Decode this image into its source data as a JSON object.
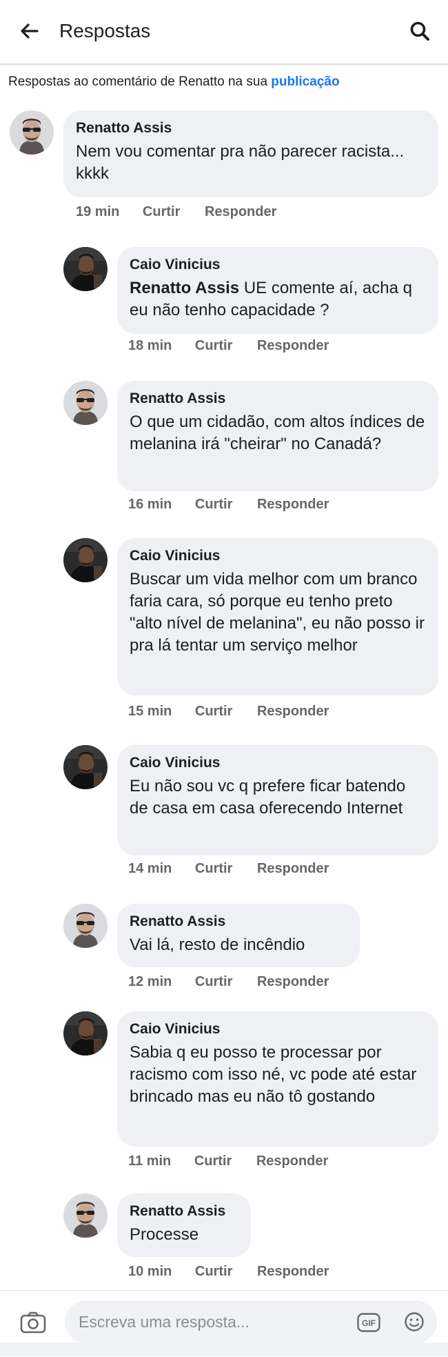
{
  "header": {
    "back_icon": "arrow-left-icon",
    "title": "Respostas",
    "search_icon": "search-icon"
  },
  "context": {
    "text": "Respostas ao comentário de Renatto na sua ",
    "link": "publicação"
  },
  "comments": [
    {
      "author": "Renatto Assis",
      "mention": "",
      "text": "Nem vou comentar pra não parecer racista... kkkk",
      "time": "19 min",
      "like": "Curtir",
      "reply": "Responder",
      "avatar": "renatto-avatar"
    },
    {
      "author": "Caio Vinicius",
      "mention": "Renatto Assis",
      "text": " UE comente aí, acha q eu não tenho capacidade ?",
      "time": "18 min",
      "like": "Curtir",
      "reply": "Responder",
      "avatar": "caio-avatar"
    },
    {
      "author": "Renatto Assis",
      "mention": "",
      "text": "O que um cidadão, com altos índices de melanina irá \"cheirar\" no Canadá?",
      "time": "16 min",
      "like": "Curtir",
      "reply": "Responder",
      "avatar": "renatto-avatar"
    },
    {
      "author": "Caio Vinicius",
      "mention": "",
      "text": "Buscar um vida melhor com um branco faria cara, só porque eu tenho preto \"alto nível de melanina\", eu não posso ir pra lá tentar um serviço melhor",
      "time": "15 min",
      "like": "Curtir",
      "reply": "Responder",
      "avatar": "caio-avatar"
    },
    {
      "author": "Caio Vinicius",
      "mention": "",
      "text": "Eu não sou vc q prefere ficar batendo de casa em casa oferecendo Internet",
      "time": "14 min",
      "like": "Curtir",
      "reply": "Responder",
      "avatar": "caio-avatar"
    },
    {
      "author": "Renatto Assis",
      "mention": "",
      "text": "Vai lá, resto de incêndio",
      "time": "12 min",
      "like": "Curtir",
      "reply": "Responder",
      "avatar": "renatto-avatar"
    },
    {
      "author": "Caio Vinicius",
      "mention": "",
      "text": "Sabia q eu posso te processar por racismo com isso né, vc pode até estar brincado mas eu não tô gostando",
      "time": "11 min",
      "like": "Curtir",
      "reply": "Responder",
      "avatar": "caio-avatar"
    },
    {
      "author": "Renatto Assis",
      "mention": "",
      "text": "Processe",
      "time": "10 min",
      "like": "Curtir",
      "reply": "Responder",
      "avatar": "renatto-avatar"
    }
  ],
  "composer": {
    "camera_icon": "camera-icon",
    "placeholder": "Escreva uma resposta...",
    "gif_icon": "gif-icon",
    "emoji_icon": "emoji-icon"
  },
  "colors": {
    "link": "#1877f2",
    "bubble": "#eef0f3",
    "meta_text": "#65676b"
  }
}
